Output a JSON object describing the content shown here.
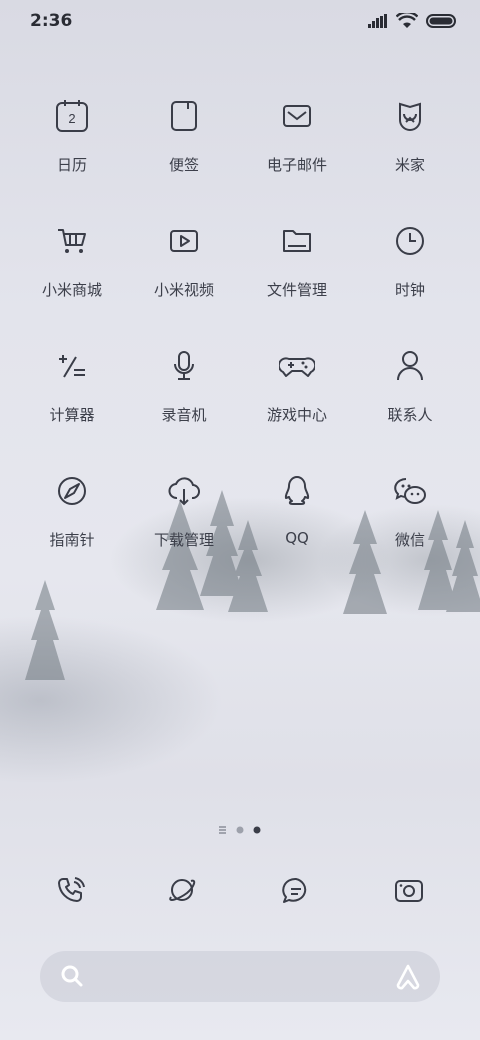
{
  "status_bar": {
    "time": "2:36"
  },
  "apps": [
    {
      "label": "日历",
      "icon": "calendar-icon",
      "day": "2"
    },
    {
      "label": "便签",
      "icon": "notes-icon"
    },
    {
      "label": "电子邮件",
      "icon": "mail-icon"
    },
    {
      "label": "米家",
      "icon": "mijia-icon"
    },
    {
      "label": "小米商城",
      "icon": "cart-icon"
    },
    {
      "label": "小米视频",
      "icon": "video-play-icon"
    },
    {
      "label": "文件管理",
      "icon": "folder-icon"
    },
    {
      "label": "时钟",
      "icon": "clock-icon"
    },
    {
      "label": "计算器",
      "icon": "calculator-icon"
    },
    {
      "label": "录音机",
      "icon": "microphone-icon"
    },
    {
      "label": "游戏中心",
      "icon": "gamepad-icon"
    },
    {
      "label": "联系人",
      "icon": "person-icon"
    },
    {
      "label": "指南针",
      "icon": "compass-icon"
    },
    {
      "label": "下载管理",
      "icon": "cloud-download-icon"
    },
    {
      "label": "QQ",
      "icon": "qq-penguin-icon"
    },
    {
      "label": "微信",
      "icon": "wechat-icon"
    }
  ],
  "page_indicator": {
    "pages": 3,
    "current": 3
  },
  "dock": [
    {
      "icon": "phone-icon"
    },
    {
      "icon": "browser-planet-icon"
    },
    {
      "icon": "message-icon"
    },
    {
      "icon": "camera-icon"
    }
  ],
  "search_bar": {
    "placeholder": "",
    "search_icon": "search-icon",
    "assistant_icon": "ai-assistant-icon"
  }
}
